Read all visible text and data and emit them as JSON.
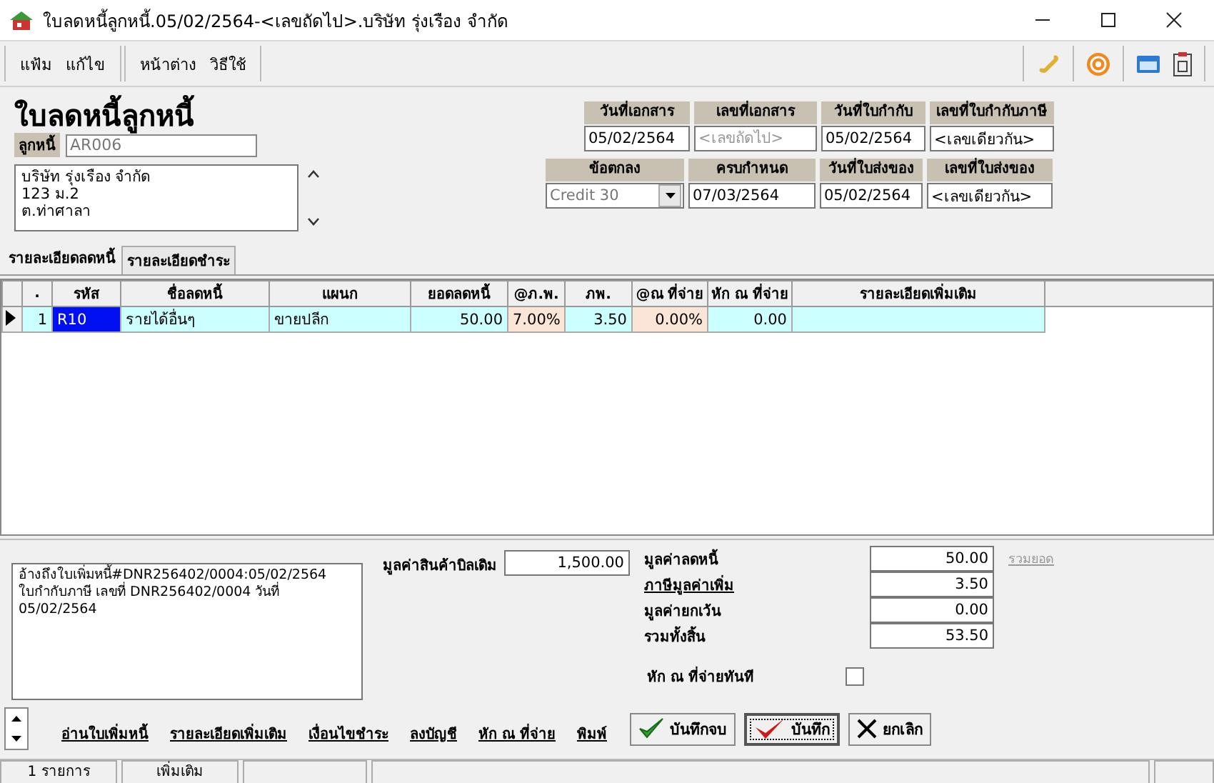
{
  "window": {
    "title": "ใบลดหนี้ลูกหนี้.05/02/2564-<เลขถัดไป>.บริษัท รุ่งเรือง จำกัด"
  },
  "menu_groups": [
    [
      "แฟ้ม",
      "แก้ไข"
    ],
    [
      "หน้าต่าง",
      "วิธีใช้"
    ]
  ],
  "form": {
    "title": "ใบลดหนี้ลูกหนี้",
    "debtor_label": "ลูกหนี้",
    "debtor_value": "AR006",
    "address": "บริษัท รุ่งเรือง จำกัด\n123 ม.2\nต.ท่าศาลา",
    "fields_row_1": [
      {
        "label": "วันที่เอกสาร",
        "value": "05/02/2564"
      },
      {
        "label": "เลขที่เอกสาร",
        "placeholder": "<เลขถัดไป>"
      },
      {
        "label": "วันที่ใบกำกับ",
        "value": "05/02/2564"
      },
      {
        "label": "เลขที่ใบกำกับภาษี",
        "value": "<เลขเดียวกัน>"
      }
    ],
    "fields_row_2": [
      {
        "label": "ข้อตกลง",
        "value": "Credit 30",
        "kind": "dropdown"
      },
      {
        "label": "ครบกำหนด",
        "value": "07/03/2564",
        "kind": "text"
      },
      {
        "label": "วันที่ใบส่งของ",
        "value": "05/02/2564",
        "kind": "text"
      },
      {
        "label": "เลขที่ใบส่งของ",
        "value": "<เลขเดียวกัน>",
        "kind": "text"
      }
    ]
  },
  "tabs": [
    {
      "label": "รายละเอียดลดหนี้",
      "selected": true
    },
    {
      "label": "รายละเอียดชำระ",
      "selected": false
    }
  ],
  "table": {
    "columns": [
      ".",
      "รหัส",
      "ชื่อลดหนี้",
      "แผนก",
      "ยอดลดหนี้",
      "@ภ.พ.",
      "ภพ.",
      "@ณ ที่จ่าย",
      "หัก ณ ที่จ่าย",
      "รายละเอียดเพิ่มเติม"
    ],
    "rows": [
      {
        "selected": true,
        "cells": [
          "1",
          "R10",
          "รายได้อื่นๆ",
          "ขายปลีก",
          "50.00",
          "7.00%",
          "3.50",
          "0.00%",
          "0.00"
        ]
      }
    ]
  },
  "note": "อ้างถึงใบเพิ่มหนี้#DNR256402/0004:05/02/2564\nใบกำกับภาษี เลขที่ DNR256402/0004 วันที่\n05/02/2564",
  "original_bill": {
    "label": "มูลค่าสินค้าบิลเดิม",
    "value": "1,500.00"
  },
  "totals": [
    {
      "label": "มูลค่าลดหนี้",
      "value": "50.00",
      "kind": "text"
    },
    {
      "label": "ภาษีมูลค่าเพิ่ม",
      "value": "3.50",
      "kind": "link"
    },
    {
      "label": "มูลค่ายกเว้น",
      "value": "0.00",
      "kind": "text"
    },
    {
      "label": "รวมทั้งสิ้น",
      "value": "53.50",
      "kind": "text"
    }
  ],
  "sum_link": {
    "label": "รวมยอด",
    "disabled": true
  },
  "withhold_now": {
    "label": "หัก ณ ที่จ่ายทันที",
    "checked": false
  },
  "links": [
    "อ่านใบเพิ่มหนี้",
    "รายละเอียดเพิ่มเติม",
    "เงื่อนไขชำระ",
    "ลงบัญชี",
    "หัก ณ ที่จ่าย",
    "พิมพ์"
  ],
  "buttons": [
    {
      "label": "บันทึกจบ",
      "kind": "save-close",
      "default": false
    },
    {
      "label": "บันทึก",
      "kind": "save",
      "default": true
    },
    {
      "label": "ยกเลิก",
      "kind": "cancel",
      "default": false
    }
  ],
  "status_bar": [
    "1 รายการ",
    "เพิ่มเติม"
  ]
}
